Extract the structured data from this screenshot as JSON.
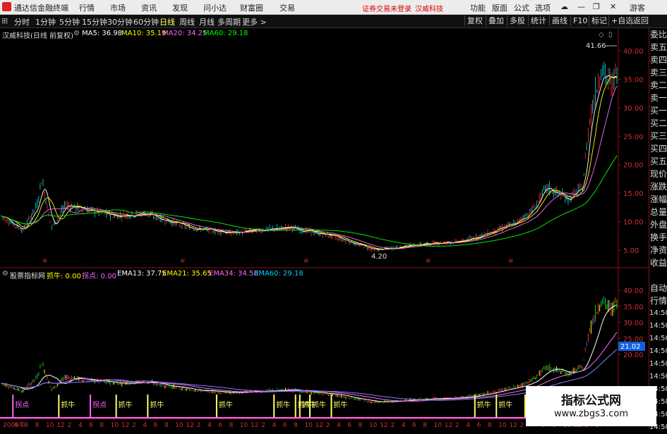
{
  "menubar": {
    "app_title": "通达信金融终端",
    "items": [
      "行情",
      "市场",
      "资讯",
      "发现",
      "问小达",
      "财富圈",
      "交易"
    ],
    "login_status": "证券交易未登录",
    "stock_name": "汉威科技",
    "right_items": [
      "功能",
      "版面",
      "公式",
      "选项"
    ],
    "user": "游客"
  },
  "periods": [
    "分时",
    "1分钟",
    "5分钟",
    "15分钟",
    "30分钟",
    "60分钟",
    "日线",
    "周线",
    "月线",
    "多周期",
    "更多 >"
  ],
  "active_period": "日线",
  "toolbar_right": [
    "复权",
    "叠加",
    "多股",
    "统计",
    "画线",
    "F10",
    "标记",
    "+自选",
    "返回"
  ],
  "main_chart": {
    "title": "汉威科技(日线 前复权)",
    "ma5": "MA5: 36.98",
    "ma10": "MA10: 35.19",
    "ma20": "MA20: 34.25",
    "ma60": "MA60: 29.18",
    "high_label": "41.66",
    "low_label": "4.20",
    "y_ticks": [
      "40.00",
      "35.00",
      "30.00",
      "25.00",
      "20.00",
      "15.00",
      "10.00",
      "5.00"
    ],
    "marker_glyph": "≋"
  },
  "indicator": {
    "title": "股票指标网",
    "zhuaniu": "抓牛: 0.00",
    "guaidian": "拐点: 0.00",
    "ema13": "EMA13: 37.75",
    "ema21": "EMA21: 35.65",
    "ema34": "EMA34: 34.58",
    "ema60": "EMA60: 29.18",
    "y_ticks": [
      "40.00",
      "35.00",
      "30.00",
      "25.00",
      "20.00"
    ],
    "value_box": "21.02",
    "signal_label_buy": "抓牛",
    "signal_label_turn": "拐点",
    "x_axis": [
      "2009年",
      "4",
      "6",
      "8",
      "10",
      "12",
      "2",
      "4",
      "6",
      "8",
      "10",
      "12",
      "2",
      "4",
      "6",
      "8",
      "10",
      "12",
      "2",
      "4",
      "6",
      "8",
      "10",
      "12",
      "2",
      "4",
      "6",
      "8",
      "10",
      "12",
      "2",
      "4",
      "6",
      "8",
      "10",
      "12",
      "2",
      "4",
      "6",
      "8",
      "10",
      "12",
      "2",
      "4",
      "6",
      "8",
      "10",
      "12",
      "2",
      "4",
      "6",
      "8",
      "10",
      "12",
      "3",
      "5",
      "7"
    ]
  },
  "sidebar": [
    "委比",
    "卖五",
    "卖四",
    "卖三",
    "卖二",
    "卖一",
    "买一",
    "买二",
    "买三",
    "买四",
    "买五",
    "现价",
    "涨跌",
    "涨幅",
    "总量",
    "外盘",
    "换手",
    "净资",
    "收益",
    "",
    "自动",
    "行情",
    "14:50",
    "14:50",
    "14:50",
    "14:50",
    "14:50",
    "14:50",
    "14:50",
    "14:50",
    "14:50",
    "14:50"
  ],
  "watermark": {
    "line1": "指标公式网",
    "line2": "www.zbgs3.com"
  },
  "colors": {
    "up": "#ff3030",
    "down": "#00e0e0",
    "ma5": "#ffffff",
    "ma10": "#ffff00",
    "ma20": "#ff66ff",
    "ma60": "#00ff00",
    "grid": "#8a1010"
  }
}
